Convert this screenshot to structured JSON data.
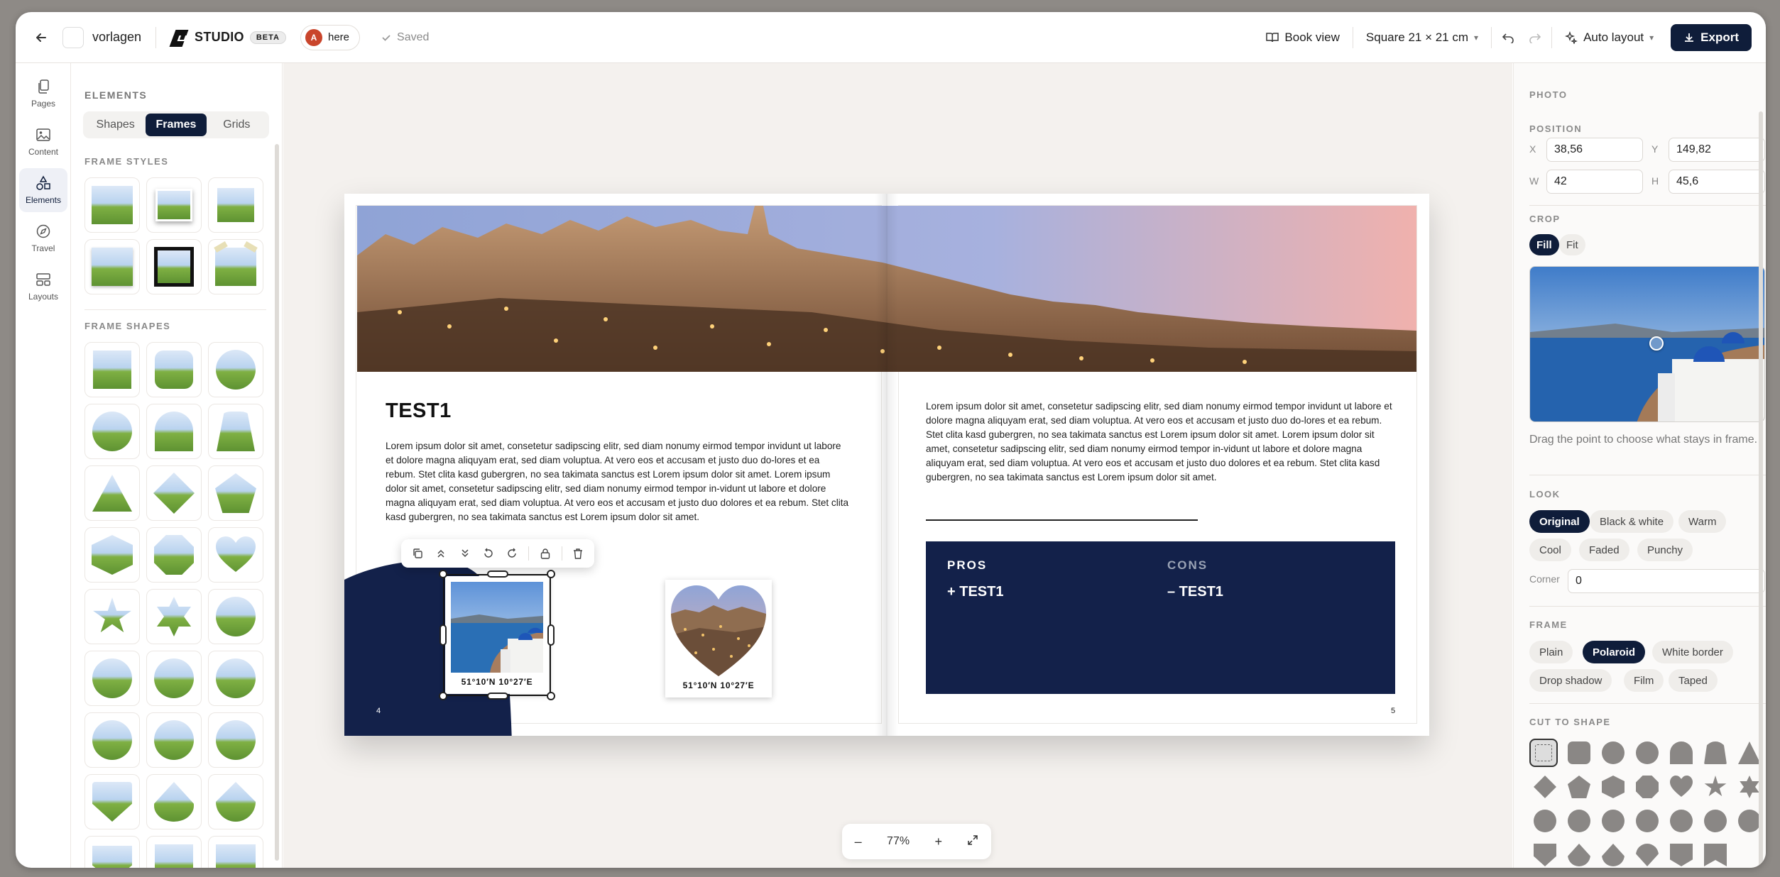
{
  "header": {
    "project_name": "vorlagen",
    "brand": "STUDIO",
    "beta_badge": "BETA",
    "user_initial": "A",
    "user_name": "here",
    "save_status": "Saved",
    "book_view": "Book view",
    "format": "Square 21 × 21 cm",
    "auto_layout": "Auto layout",
    "export": "Export"
  },
  "rail": [
    {
      "label": "Pages",
      "icon": "pages-icon"
    },
    {
      "label": "Content",
      "icon": "image-icon"
    },
    {
      "label": "Elements",
      "icon": "shapes-icon"
    },
    {
      "label": "Travel",
      "icon": "compass-icon"
    },
    {
      "label": "Layouts",
      "icon": "layout-icon"
    }
  ],
  "elements_panel": {
    "title": "ELEMENTS",
    "tabs": [
      "Shapes",
      "Frames",
      "Grids"
    ],
    "active_tab": "Frames",
    "frame_styles_label": "FRAME STYLES",
    "frame_shapes_label": "FRAME SHAPES"
  },
  "spread": {
    "left": {
      "heading": "TEST1",
      "body": "Lorem ipsum dolor sit amet, consetetur sadipscing elitr, sed diam nonumy eirmod tempor invidunt ut labore et dolore magna aliquyam erat, sed diam voluptua. At vero eos et accusam et justo duo do-lores et ea rebum. Stet clita kasd gubergren, no sea takimata sanctus est Lorem ipsum dolor sit amet. Lorem ipsum dolor sit amet, consetetur sadipscing elitr, sed diam nonumy eirmod tempor in-vidunt ut labore et dolore magna aliquyam erat, sed diam voluptua. At vero eos et accusam et justo duo dolores et ea rebum. Stet clita kasd gubergren, no sea takimata sanctus est Lorem ipsum dolor sit amet.",
      "photo1_caption": "51°10′N 10°27′E",
      "photo2_caption": "51°10′N 10°27′E",
      "page_number": "4"
    },
    "right": {
      "body": "Lorem ipsum dolor sit amet, consetetur sadipscing elitr, sed diam nonumy eirmod tempor invidunt ut labore et dolore magna aliquyam erat, sed diam voluptua. At vero eos et accusam et justo duo do-lores et ea rebum. Stet clita kasd gubergren, no sea takimata sanctus est Lorem ipsum dolor sit amet. Lorem ipsum dolor sit amet, consetetur sadipscing elitr, sed diam nonumy eirmod tempor in-vidunt ut labore et dolore magna aliquyam erat, sed diam voluptua. At vero eos et accusam et justo duo dolores et ea rebum. Stet clita kasd gubergren, no sea takimata sanctus est Lorem ipsum dolor sit amet.",
      "pros_label": "PROS",
      "cons_label": "CONS",
      "pros_item": "+ TEST1",
      "cons_item": "– TEST1",
      "page_number": "5"
    }
  },
  "zoom": {
    "value": "77%"
  },
  "properties": {
    "title": "PHOTO",
    "position_label": "POSITION",
    "x_label": "X",
    "x": "38,56",
    "y_label": "Y",
    "y": "149,82",
    "w_label": "W",
    "w": "42",
    "h_label": "H",
    "h": "45,6",
    "crop_label": "CROP",
    "crop_options": [
      "Fill",
      "Fit"
    ],
    "crop_active": "Fill",
    "crop_hint": "Drag the point to choose what stays in frame.",
    "look_label": "LOOK",
    "look_options": [
      "Original",
      "Black & white",
      "Warm",
      "Cool",
      "Faded",
      "Punchy"
    ],
    "look_active": "Original",
    "corner_label": "Corner",
    "corner_value": "0",
    "frame_label": "FRAME",
    "frame_options": [
      "Plain",
      "Polaroid",
      "White border",
      "Drop shadow",
      "Film",
      "Taped"
    ],
    "frame_active": "Polaroid",
    "cut_label": "CUT TO SHAPE"
  },
  "colors": {
    "navy": "#0f1d3a",
    "accent_user": "#c9452b",
    "cons_text": "#9aa3b5"
  }
}
